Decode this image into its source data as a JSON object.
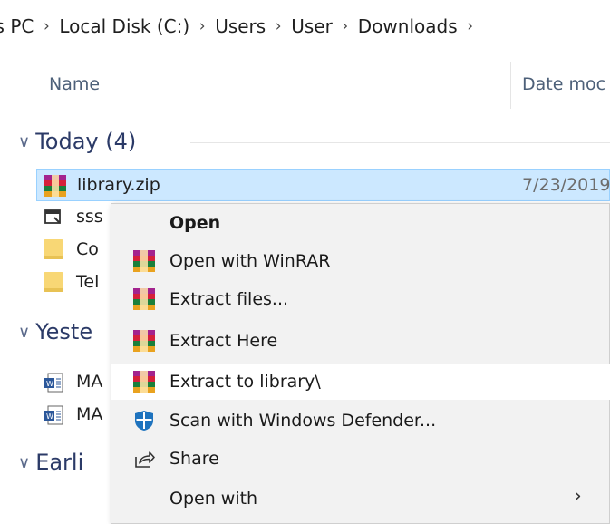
{
  "breadcrumb": {
    "items": [
      "is PC",
      "Local Disk (C:)",
      "Users",
      "User",
      "Downloads"
    ],
    "separator": "›"
  },
  "columns": {
    "name": "Name",
    "date": "Date moc"
  },
  "groups": {
    "today": {
      "label": "Today (4)"
    },
    "yesterday": {
      "label": "Yeste"
    },
    "earlier": {
      "label": "Earli"
    }
  },
  "files": {
    "today": [
      {
        "name": "library.zip",
        "date": "7/23/2019",
        "icon": "winrar-icon",
        "selected": true
      },
      {
        "name": "sss",
        "icon": "app-icon"
      },
      {
        "name": "Co",
        "icon": "folder-icon"
      },
      {
        "name": "Tel",
        "icon": "folder-icon"
      }
    ],
    "yesterday": [
      {
        "name": "MA",
        "icon": "word-doc-icon"
      },
      {
        "name": "MA",
        "icon": "word-doc-icon"
      }
    ]
  },
  "context_menu": {
    "items": [
      {
        "label": "Open",
        "bold": true,
        "icon": ""
      },
      {
        "label": "Open with WinRAR",
        "icon": "winrar-icon"
      },
      {
        "label": "Extract files...",
        "icon": "winrar-icon"
      },
      {
        "label": "Extract Here",
        "icon": "winrar-icon"
      },
      {
        "label": "Extract to library\\",
        "icon": "winrar-icon",
        "highlighted": true
      },
      {
        "label": "Scan with Windows Defender...",
        "icon": "windows-defender-icon"
      },
      {
        "label": "Share",
        "icon": "share-icon"
      },
      {
        "label": "Open with",
        "icon": "",
        "submenu_arrow": "›"
      }
    ]
  },
  "colors": {
    "selection_bg": "#cce8ff",
    "selection_border": "#99d1ff",
    "menu_bg": "#f2f2f2",
    "group_text": "#2b3a67",
    "column_header_text": "#4d6079"
  }
}
